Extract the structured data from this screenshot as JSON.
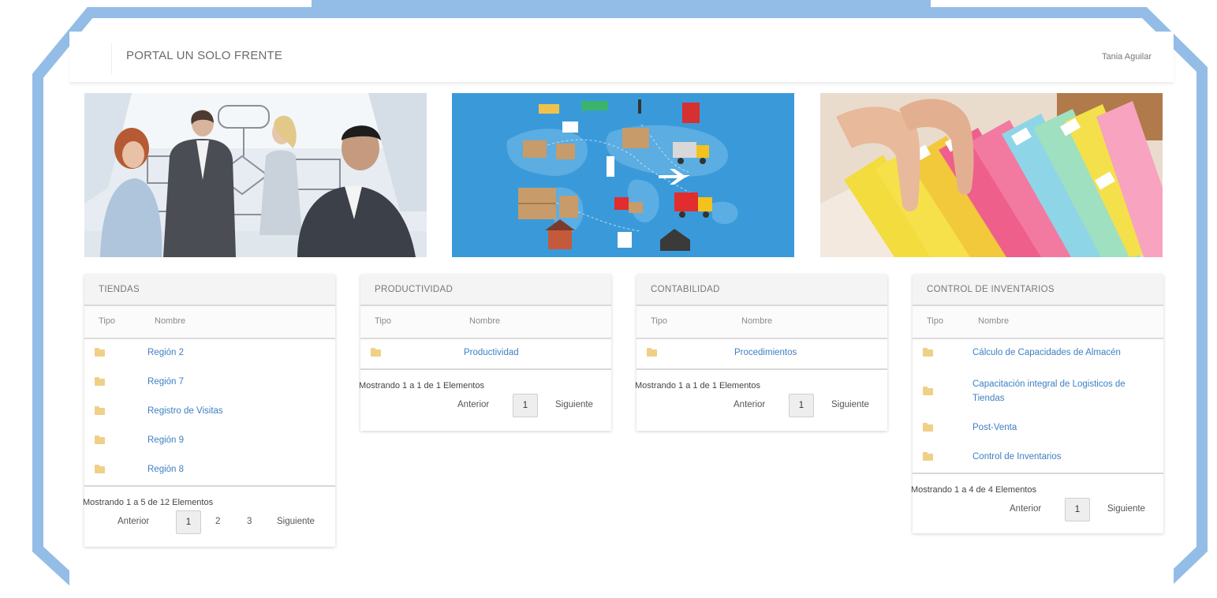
{
  "header": {
    "brand": "PORTAL UN SOLO FRENTE",
    "user": "Tania Aguilar"
  },
  "banners": [
    {
      "name": "business-meeting",
      "color": "#e9eef3"
    },
    {
      "name": "logistics-map",
      "color": "#3a9ad9"
    },
    {
      "name": "file-folders",
      "color": "#e6d6c4"
    }
  ],
  "panels": [
    {
      "title": "TIENDAS",
      "col_tipo": "Tipo",
      "col_nombre": "Nombre",
      "rows": [
        "Región 2",
        "Región 7",
        "Registro de Visitas",
        "Región 9",
        "Región 8"
      ],
      "info": "Mostrando 1 a 5 de 12 Elementos",
      "prev": "Anterior",
      "pages": [
        "1",
        "2",
        "3"
      ],
      "next": "Siguiente"
    },
    {
      "title": "PRODUCTIVIDAD",
      "col_tipo": "Tipo",
      "col_nombre": "Nombre",
      "rows": [
        "Productividad"
      ],
      "info": "Mostrando 1 a 1 de 1 Elementos",
      "prev": "Anterior",
      "pages": [
        "1"
      ],
      "next": "Siguiente"
    },
    {
      "title": "CONTABILIDAD",
      "col_tipo": "Tipo",
      "col_nombre": "Nombre",
      "rows": [
        "Procedimientos"
      ],
      "info": "Mostrando 1 a 1 de 1 Elementos",
      "prev": "Anterior",
      "pages": [
        "1"
      ],
      "next": "Siguiente"
    },
    {
      "title": "CONTROL DE INVENTARIOS",
      "col_tipo": "Tipo",
      "col_nombre": "Nombre",
      "rows": [
        "Cálculo de Capacidades de Almacén",
        "Capacitación integral de Logisticos de Tiendas",
        "Post-Venta",
        "Control de Inventarios"
      ],
      "info": "Mostrando 1 a 4 de 4 Elementos",
      "prev": "Anterior",
      "pages": [
        "1"
      ],
      "next": "Siguiente"
    }
  ],
  "colors": {
    "frame": "#93bde6",
    "link": "#3f7fc1",
    "folder": "#f0d086"
  }
}
